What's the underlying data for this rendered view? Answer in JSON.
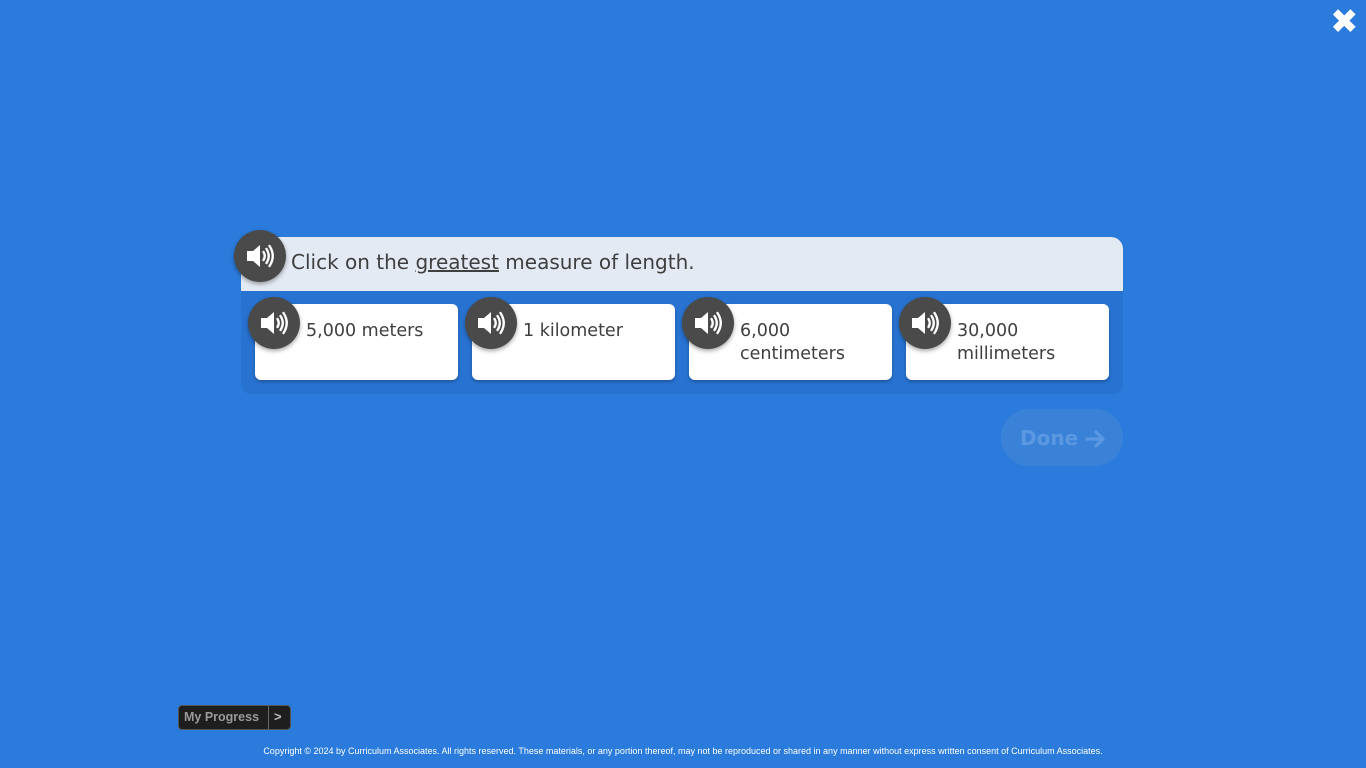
{
  "close": {
    "icon": "close-icon"
  },
  "question": {
    "prompt_before": "Click on the ",
    "prompt_emphasis": "greatest",
    "prompt_after": " measure of length.",
    "audio_icon": "speaker-icon"
  },
  "choices": [
    {
      "label": "5,000 meters"
    },
    {
      "label": "1 kilometer"
    },
    {
      "label": "6,000 centimeters"
    },
    {
      "label": "30,000 millimeters"
    }
  ],
  "done": {
    "label": "Done",
    "icon": "arrow-right-icon"
  },
  "progress": {
    "label": "My Progress",
    "arrow": ">"
  },
  "footer": {
    "copyright": "Copyright © 2024 by Curriculum Associates. All rights reserved. These materials, or any portion thereof, may not be reproduced or shared in any manner without express written consent of Curriculum Associates."
  },
  "colors": {
    "background": "#2a7bdc",
    "prompt_bg": "#e3eaf3",
    "audio_button": "#4a4a4a",
    "done_disabled": "#3a82d8"
  }
}
